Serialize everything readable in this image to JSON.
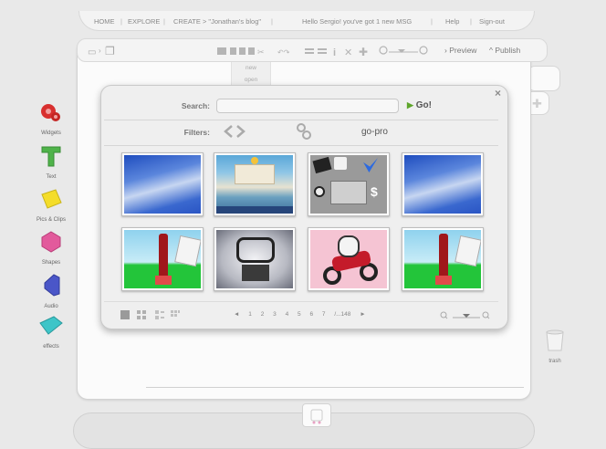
{
  "nav": {
    "home": "HOME",
    "explore": "EXPLORE",
    "create": "CREATE > \"Jonathan's blog\"",
    "greeting": "Hello Sergio! you've got 1 new MSG",
    "help": "Help",
    "signout": "Sign-out"
  },
  "toolbar": {
    "preview": "Preview",
    "publish": "Publish",
    "menu_new": "new",
    "menu_open": "open"
  },
  "tools": [
    {
      "label": "Widgets",
      "icon": "gear-cluster-icon",
      "color": "#d8302f"
    },
    {
      "label": "Text",
      "icon": "text-t-icon",
      "color": "#4fb34a"
    },
    {
      "label": "Pics & Clips",
      "icon": "picture-icon",
      "color": "#f4dd2a"
    },
    {
      "label": "Shapes",
      "icon": "hexagon-shape-icon",
      "color": "#e25a9c"
    },
    {
      "label": "Audio",
      "icon": "speaker-icon",
      "color": "#4a56c8"
    },
    {
      "label": "effects",
      "icon": "effects-gem-icon",
      "color": "#3ec5c8"
    }
  ],
  "dialog": {
    "search_label": "Search:",
    "search_value": "",
    "go_label": "Go!",
    "filters_label": "Filters:",
    "filter_gopro": "go-pro",
    "close": "×"
  },
  "thumbnails": [
    {
      "kind": "sky"
    },
    {
      "kind": "resort"
    },
    {
      "kind": "collage"
    },
    {
      "kind": "sky"
    },
    {
      "kind": "beach"
    },
    {
      "kind": "logo"
    },
    {
      "kind": "motorbike"
    },
    {
      "kind": "beach"
    }
  ],
  "pager": {
    "prev": "◄",
    "pages": [
      "1",
      "2",
      "3",
      "4",
      "5",
      "6",
      "7",
      "/...148"
    ],
    "next": "►"
  },
  "trash_label": "trash"
}
